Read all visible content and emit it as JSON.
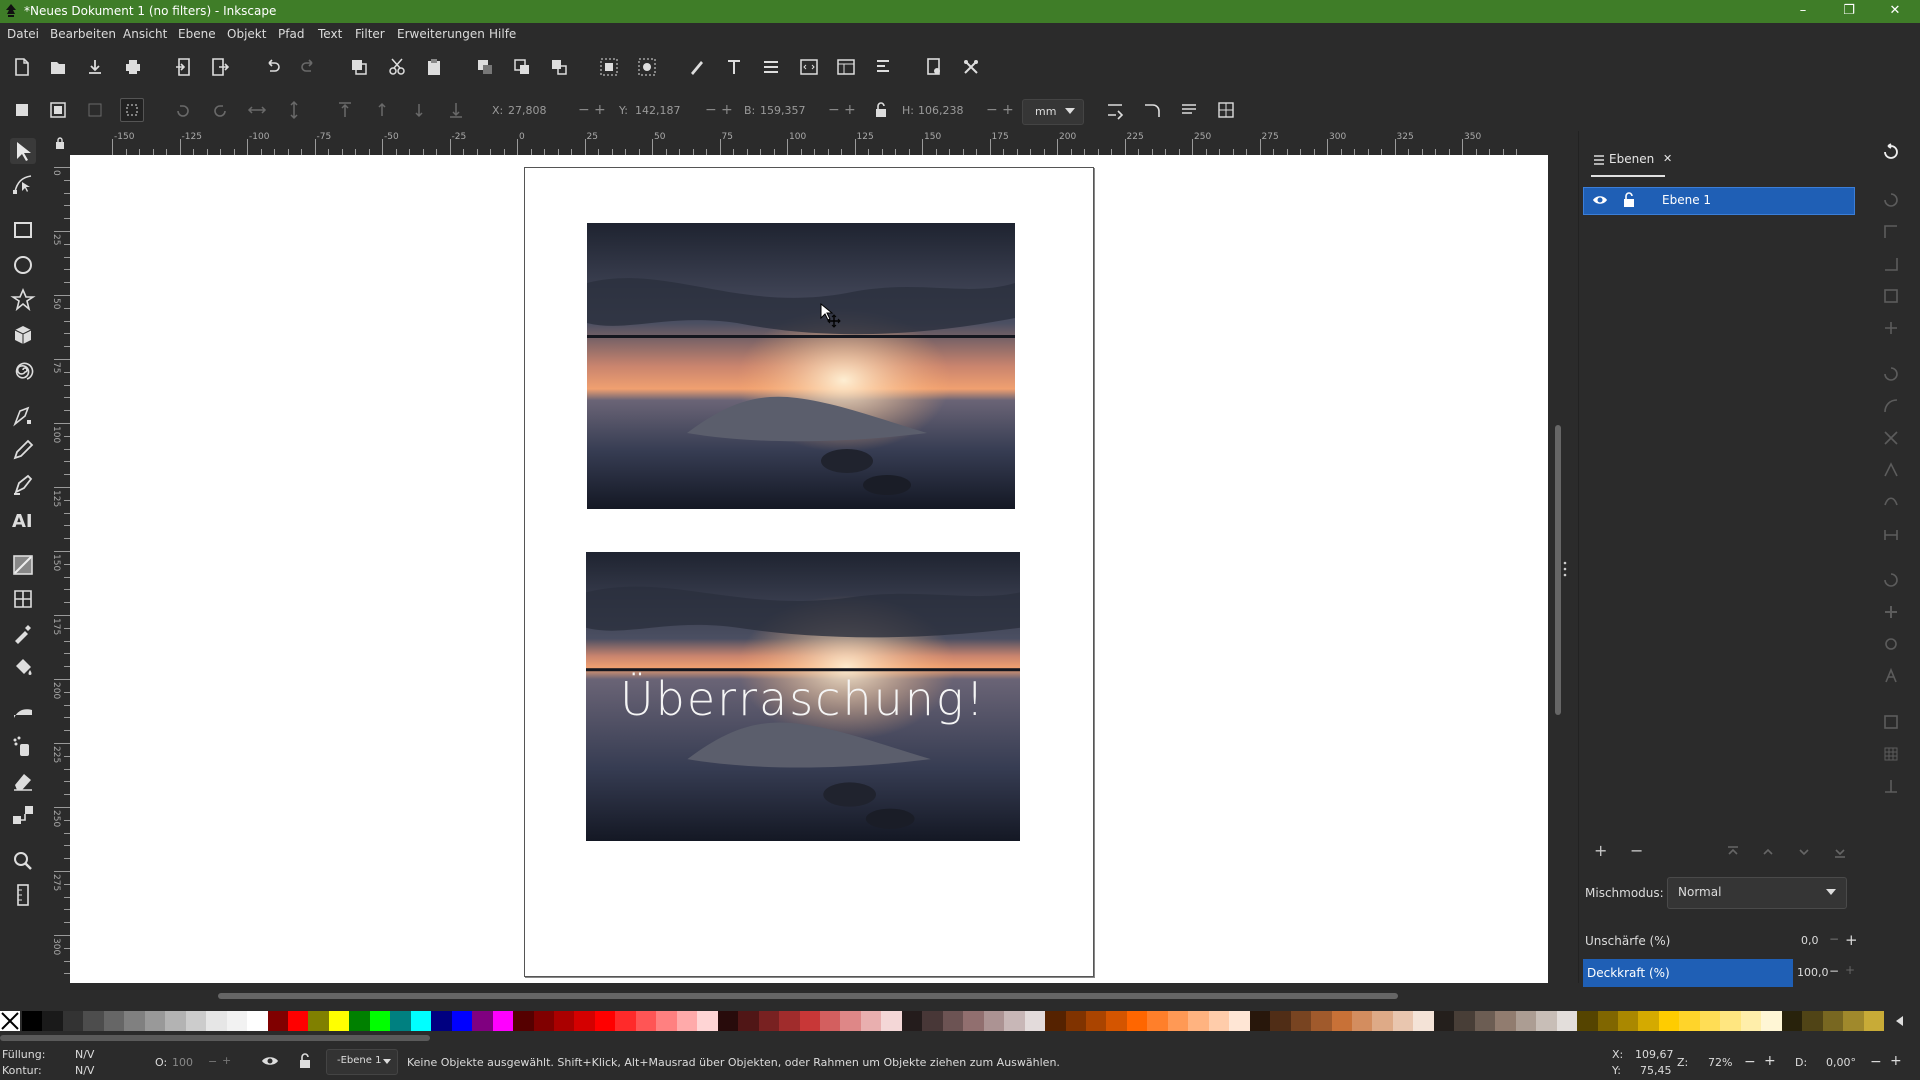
{
  "window": {
    "title": "*Neues Dokument 1 (no filters) - Inkscape",
    "minimize": "–",
    "restore": "❐",
    "close": "✕"
  },
  "menu": [
    "Datei",
    "Bearbeiten",
    "Ansicht",
    "Ebene",
    "Objekt",
    "Pfad",
    "Text",
    "Filter",
    "Erweiterungen",
    "Hilfe"
  ],
  "tool_controls": {
    "x_label": "X:",
    "x_value": "27,808",
    "y_label": "Y:",
    "y_value": "142,187",
    "w_label": "B:",
    "w_value": "159,357",
    "h_label": "H:",
    "h_value": "106,238",
    "unit": "mm",
    "minus": "−",
    "plus": "+"
  },
  "ruler": {
    "h_labels": [
      "-150",
      "-125",
      "-100",
      "-75",
      "-50",
      "-25",
      "0",
      "25",
      "50",
      "75",
      "100",
      "125",
      "150",
      "175",
      "200",
      "225",
      "250",
      "275",
      "300",
      "325",
      "350"
    ],
    "v_labels": [
      "0",
      "25",
      "50",
      "75",
      "100",
      "125",
      "150",
      "175",
      "200",
      "225",
      "250",
      "275",
      "300"
    ]
  },
  "canvas": {
    "overlay_text": "Überraschung!"
  },
  "dock": {
    "tab_label": "Ebenen",
    "tab_close": "✕",
    "layer_name": "Ebene 1",
    "add_layer": "+",
    "remove_layer": "−",
    "blend_label": "Mischmodus:",
    "blend_value": "Normal",
    "blur_label": "Unschärfe (%)",
    "blur_value": "0,0",
    "opacity_label": "Deckkraft (%)",
    "opacity_value": "100,0"
  },
  "palette": {
    "colors": [
      "#000000",
      "#1a1a1a",
      "#333333",
      "#4d4d4d",
      "#666666",
      "#808080",
      "#999999",
      "#b3b3b3",
      "#cccccc",
      "#e6e6e6",
      "#f2f2f2",
      "#ffffff",
      "#800000",
      "#ff0000",
      "#808000",
      "#ffff00",
      "#008000",
      "#00ff00",
      "#008080",
      "#00ffff",
      "#000080",
      "#0000ff",
      "#800080",
      "#ff00ff",
      "#550000",
      "#800000",
      "#aa0000",
      "#d40000",
      "#ff0000",
      "#ff2a2a",
      "#ff5555",
      "#ff8080",
      "#ffaaaa",
      "#ffd5d5",
      "#280b0b",
      "#501616",
      "#782121",
      "#a02c2c",
      "#c83737",
      "#d35f5f",
      "#de8787",
      "#e9afaf",
      "#f4d7d7",
      "#241c1c",
      "#483737",
      "#6c5353",
      "#916f6f",
      "#ac9393",
      "#c8b7b7",
      "#e3dbdb",
      "#552200",
      "#803300",
      "#aa4400",
      "#d45500",
      "#ff6600",
      "#ff7f2a",
      "#ff9955",
      "#ffb380",
      "#ffccaa",
      "#ffe6d5",
      "#28170b",
      "#502d16",
      "#784421",
      "#a05a2c",
      "#c87137",
      "#d38d5f",
      "#deaa87",
      "#e9c6af",
      "#f4e3d7",
      "#241f1c",
      "#483e37",
      "#6c5d53",
      "#917c6f",
      "#ac9d93",
      "#c8beb7",
      "#e3dedb",
      "#554400",
      "#806600",
      "#aa8800",
      "#d4aa00",
      "#ffcc00",
      "#ffd42a",
      "#ffdd55",
      "#ffe680",
      "#ffeeaa",
      "#fff6d5",
      "#28220b",
      "#504416",
      "#786721",
      "#a0892c",
      "#c8ab37"
    ]
  },
  "status": {
    "fill_label": "Füllung:",
    "fill_value": "N/V",
    "stroke_label": "Kontur:",
    "stroke_value": "N/V",
    "opacity_label": "O:",
    "opacity_value": "100",
    "layer": "-Ebene 1",
    "message": "Keine Objekte ausgewählt. Shift+Klick, Alt+Mausrad über Objekten, oder Rahmen um Objekte ziehen zum Auswählen.",
    "cursor_x_label": "X:",
    "cursor_x": "109,67",
    "cursor_y_label": "Y:",
    "cursor_y": "75,45",
    "zoom_label": "Z:",
    "zoom": "72%",
    "rotation_label": "D:",
    "rotation": "0,00°"
  }
}
